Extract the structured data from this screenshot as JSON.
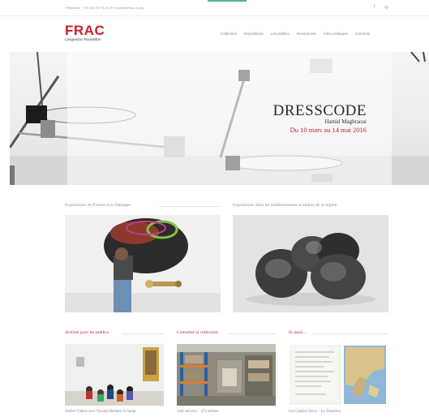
{
  "topbar": {
    "contact": "Téléphone : +33 (0)4 99 74 20 35 | contact@frac-lr.org",
    "social": [
      {
        "icon": "facebook-icon",
        "glyph": "f"
      },
      {
        "icon": "rss-icon",
        "glyph": "⊛"
      }
    ],
    "accent_color": "#55b38a"
  },
  "logo": {
    "brand": "FRAC",
    "region": "Languedoc-Roussillon",
    "color": "#c8202f"
  },
  "nav": {
    "items": [
      {
        "label": "Collection"
      },
      {
        "label": "Expositions"
      },
      {
        "label": "Les publics"
      },
      {
        "label": "Ressources"
      },
      {
        "label": "Infos pratiques"
      },
      {
        "label": "Contacts"
      }
    ]
  },
  "hero": {
    "title": "DRESSCODE",
    "artist": "Hamid Maghraoui",
    "dates": "Du 10 mars au 14 mai 2016"
  },
  "sections": {
    "expo_france": {
      "title": "Expositions en France et à l'étranger"
    },
    "expo_schools": {
      "title": "Expositions dans les établissements scolaires de la région"
    },
    "actions": {
      "title": "Actions pour les publics",
      "caption": "Atelier Vidéos avec Vincent Bethèze et Sarah"
    },
    "collection": {
      "title": "Consulter la collection",
      "caption": "1445 œuvres – 473 artistes"
    },
    "more": {
      "title": "Et aussi...",
      "caption": "Les Cahiers Sèvre – La Tentation"
    }
  }
}
